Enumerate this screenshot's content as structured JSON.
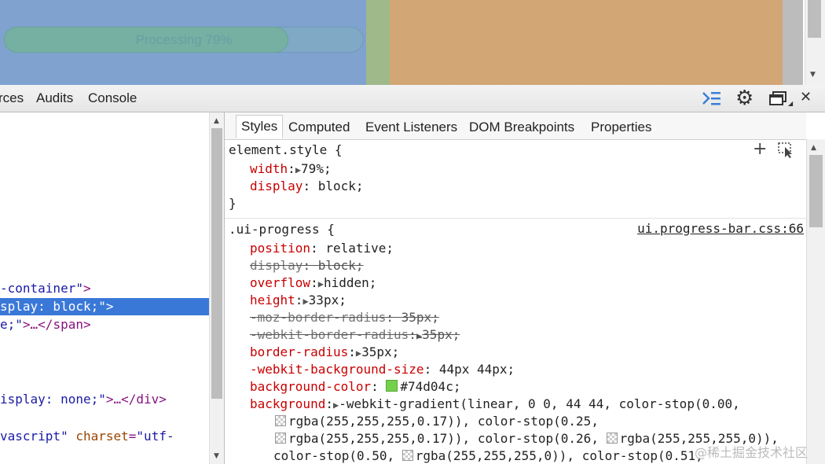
{
  "page": {
    "progress": {
      "value": 0.79,
      "label": "Processing 79%"
    }
  },
  "toolbar": {
    "tabs": [
      "rces",
      "Audits",
      "Console"
    ]
  },
  "elements": {
    "lines": [
      {
        "pre": "",
        "tag1": "",
        "attr": "",
        "val": "-container\"",
        "tag2": ">"
      },
      {
        "pre": "splay: block;\">",
        "tag1": "",
        "attr": "",
        "val": "",
        "tag2": ""
      },
      {
        "pre": "",
        "tag1": "",
        "attr": "",
        "val": "e;\"",
        "tag2": ">…</span>"
      },
      {
        "pre": "",
        "tag1": "",
        "attr": "",
        "val": "isplay: none;\"",
        "tag2": ">…</div>"
      },
      {
        "pre": "",
        "tag1": "",
        "attr": "",
        "val": "vascript\"",
        "tag2": ""
      }
    ],
    "charset_attr": "charset",
    "charset_val": "\"utf-"
  },
  "sidebar": {
    "tabs": [
      "Styles",
      "Computed",
      "Event Listeners",
      "DOM Breakpoints",
      "Properties"
    ],
    "element_style": {
      "selector": "element.style {",
      "props": [
        {
          "name": "width",
          "value": "79%;"
        },
        {
          "name": "display",
          "value": "block;"
        }
      ],
      "close": "}"
    },
    "rule": {
      "selector": ".ui-progress {",
      "source": "ui.progress-bar.css:66",
      "props": [
        {
          "name": "position",
          "value": "relative;"
        },
        {
          "name": "display",
          "value": "block;"
        },
        {
          "name": "overflow",
          "value": "hidden;"
        },
        {
          "name": "height",
          "value": "33px;"
        },
        {
          "name": "-moz-border-radius",
          "value": "35px;"
        },
        {
          "name": "-webkit-border-radius",
          "value": "35px;"
        },
        {
          "name": "border-radius",
          "value": "35px;"
        },
        {
          "name": "-webkit-background-size",
          "value": "44px 44px;"
        },
        {
          "name": "background-color",
          "value": "#74d04c;"
        },
        {
          "name": "background",
          "value": "-webkit-gradient(linear, 0 0, 44 44, color-stop(0.00,"
        }
      ],
      "continuation": [
        {
          "text": "rgba(255,255,255,0.17)), color-stop(0.25,"
        },
        {
          "text1": "rgba(255,255,255,0.17)), color-stop(0.26, ",
          "text2": "rgba(255,255,255,0)),"
        },
        {
          "pre": "color-stop(0.50, ",
          "text": "rgba(255,255,255,0)), color-stop(0.51,"
        }
      ]
    }
  },
  "watermark": "@稀土掘金技术社区",
  "colors": {
    "selection": "#3a78d8",
    "progress_fill": "#74d04c"
  }
}
